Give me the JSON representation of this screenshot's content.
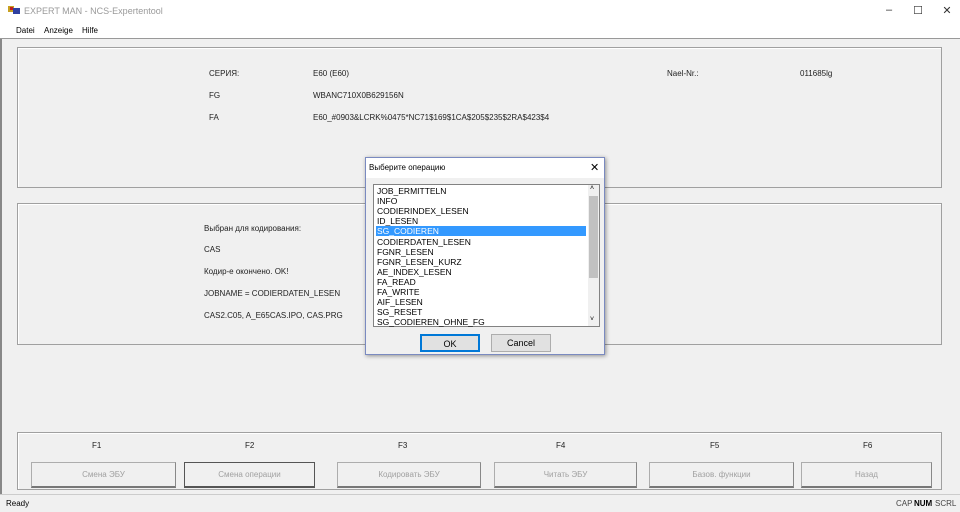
{
  "window": {
    "title": "EXPERT  MAN - NCS-Expertentool"
  },
  "menu": [
    "Datei",
    "Anzeige",
    "Hilfe"
  ],
  "info": {
    "series_label": "СЕРИЯ:",
    "series_value": "E60 (E60)",
    "fg_label": "FG",
    "fg_value": "WBANC710X0B629156N",
    "fa_label": "FA",
    "fa_value": "E60_#0903&LCRK%0475*NC71$169$1CA$205$235$2RA$423$4",
    "nael_label": "Nael-Nr.:",
    "nael_value": "011685lg"
  },
  "result": {
    "line1": "Выбран для кодирования:",
    "line2": "CAS",
    "line3": "Кодир-е окончено. OK!",
    "line4": "JOBNAME = CODIERDATEN_LESEN",
    "line5": "CAS2.C05, A_E65CAS.IPO, CAS.PRG"
  },
  "fkeys": [
    {
      "key": "F1",
      "label": "Смена ЭБУ"
    },
    {
      "key": "F2",
      "label": "Смена операции"
    },
    {
      "key": "F3",
      "label": "Кодировать ЭБУ"
    },
    {
      "key": "F4",
      "label": "Читать ЭБУ"
    },
    {
      "key": "F5",
      "label": "Базов. функции"
    },
    {
      "key": "F6",
      "label": "Назад"
    }
  ],
  "dialog": {
    "title": "Выберите операцию",
    "ok": "OK",
    "cancel": "Cancel",
    "selected": "SG_CODIEREN",
    "items": [
      "JOB_ERMITTELN",
      "INFO",
      "CODIERINDEX_LESEN",
      "ID_LESEN",
      "SG_CODIEREN",
      "CODIERDATEN_LESEN",
      "FGNR_LESEN",
      "FGNR_LESEN_KURZ",
      "AE_INDEX_LESEN",
      "FA_READ",
      "FA_WRITE",
      "AIF_LESEN",
      "SG_RESET",
      "SG_CODIEREN_OHNE_FG"
    ]
  },
  "status": {
    "text": "Ready",
    "cap": "CAP",
    "num": "NUM",
    "scrl": "SCRL"
  },
  "colors": {
    "selection": "#3399ff"
  }
}
